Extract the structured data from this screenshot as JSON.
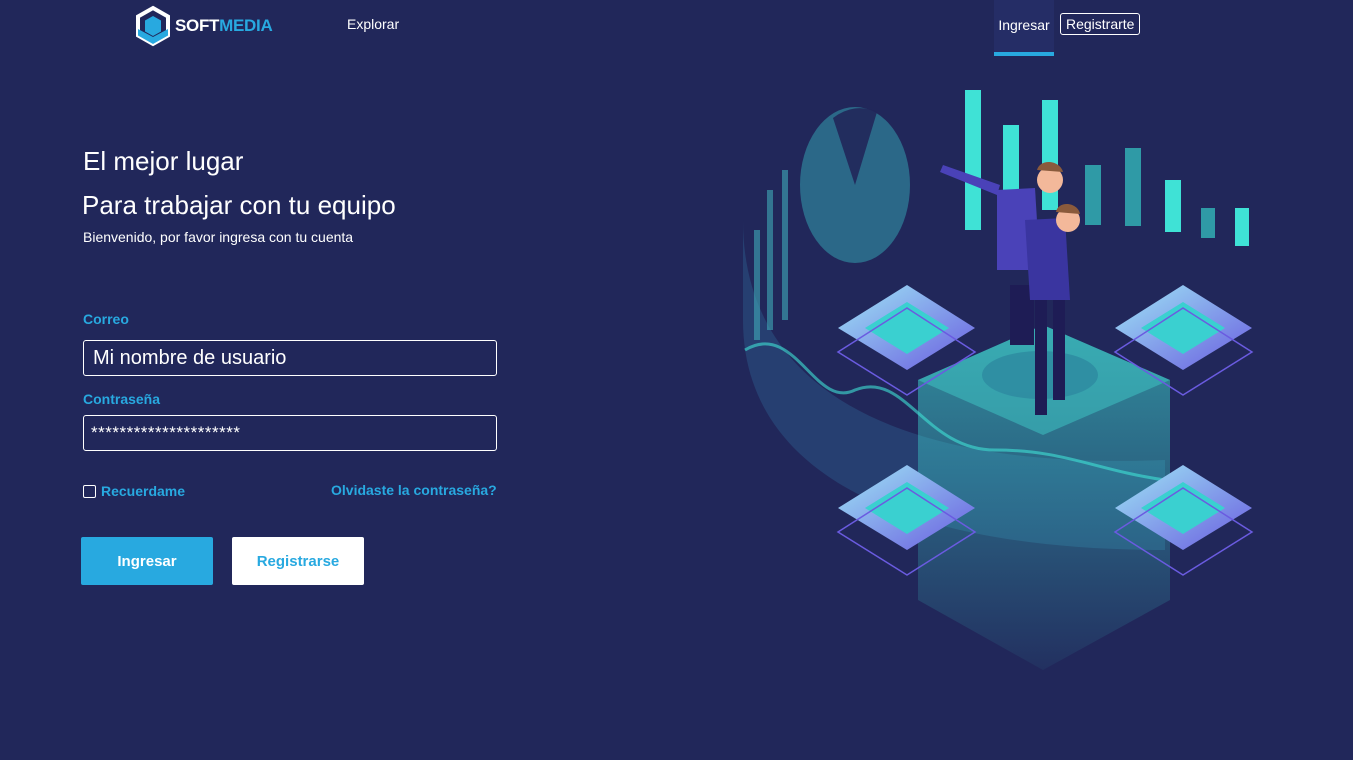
{
  "header": {
    "logo": {
      "part1": "SOFT",
      "part2": "MEDIA"
    },
    "nav_explore": "Explorar",
    "nav_login": "Ingresar",
    "nav_register": "Registrarte"
  },
  "hero": {
    "title_line1": "El mejor lugar",
    "title_line2": "Para trabajar con tu equipo",
    "subtitle": "Bienvenido, por favor ingresa con tu cuenta"
  },
  "form": {
    "email_label": "Correo",
    "email_value": "Mi nombre de usuario",
    "password_label": "Contraseña",
    "password_value": "*********************",
    "remember_label": "Recuerdame",
    "remember_checked": false,
    "forgot_link": "Olvidaste la contraseña?",
    "login_button": "Ingresar",
    "register_button": "Registrarse"
  },
  "colors": {
    "background": "#21275a",
    "accent": "#28a9e0",
    "text": "#ffffff",
    "illustration_teal": "#3fe2d6"
  }
}
